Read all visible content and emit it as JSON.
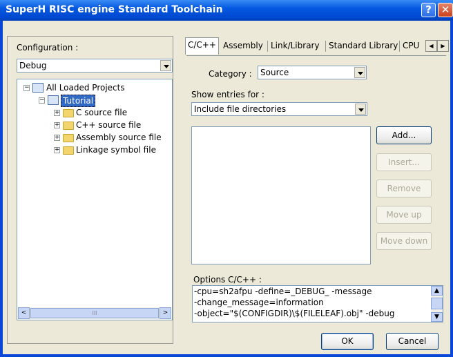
{
  "window": {
    "title": "SuperH RISC engine Standard Toolchain",
    "help_label": "?",
    "close_label": "✕"
  },
  "left": {
    "config_label": "Configuration :",
    "config_value": "Debug",
    "tree": {
      "root": "All Loaded Projects",
      "project": "Tutorial",
      "children": [
        "C source file",
        "C++ source file",
        "Assembly source file",
        "Linkage symbol file"
      ]
    },
    "scroll_left": "<",
    "scroll_right": ">",
    "scroll_grip": "III"
  },
  "tabs": [
    "C/C++",
    "Assembly",
    "Link/Library",
    "Standard Library",
    "CPU"
  ],
  "tab_nav": {
    "prev": "◀",
    "next": "▶"
  },
  "main": {
    "category_label": "Category :",
    "category_value": "Source",
    "show_entries_label": "Show entries for :",
    "show_entries_value": "Include file directories",
    "buttons": {
      "add": "Add...",
      "insert": "Insert...",
      "remove": "Remove",
      "move_up": "Move up",
      "move_down": "Move down"
    },
    "options_label": "Options C/C++ :",
    "options_lines": [
      "-cpu=sh2afpu -define=_DEBUG_ -message",
      "-change_message=information",
      "-object=\"$(CONFIGDIR)\\$(FILELEAF).obj\" -debug"
    ]
  },
  "footer": {
    "ok": "OK",
    "cancel": "Cancel"
  }
}
